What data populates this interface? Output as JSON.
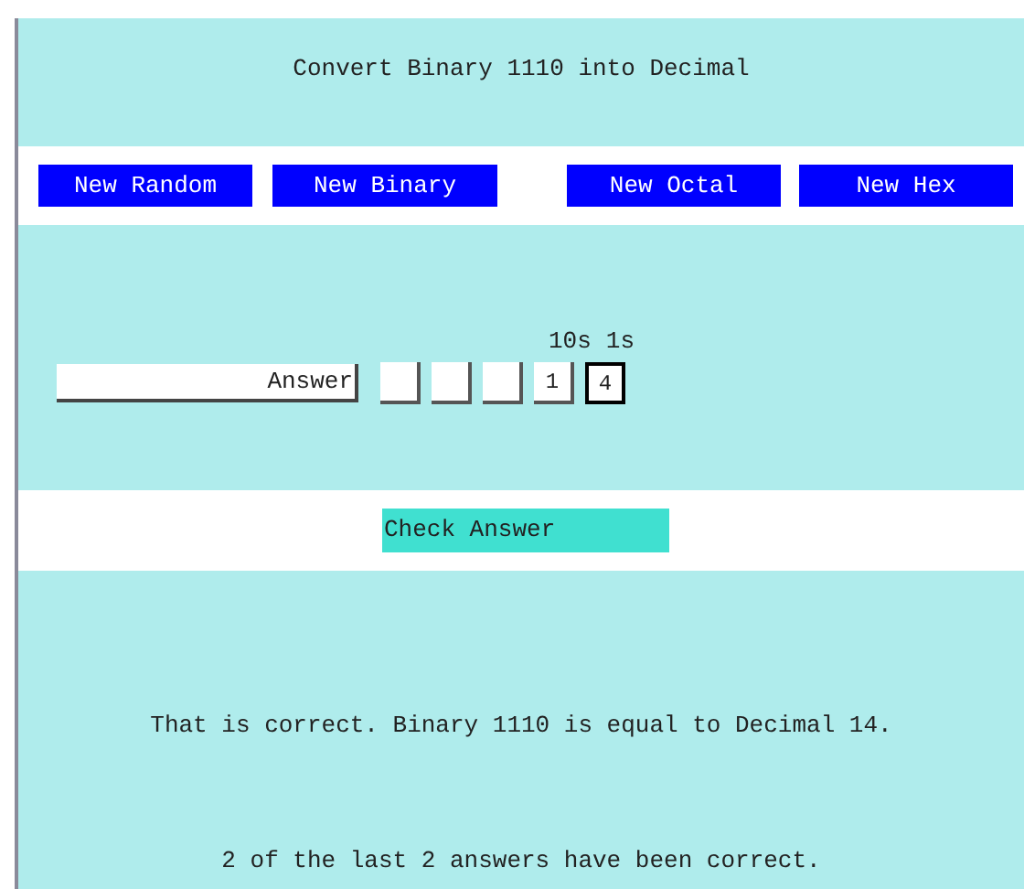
{
  "title": "Convert Binary 1110 into Decimal",
  "buttons": [
    "New Random",
    "New Binary",
    "New Octal",
    "New Hex"
  ],
  "place_labels": [
    "10s",
    "1s"
  ],
  "answer_label": "Answer",
  "digits": [
    {
      "focused": false
    },
    {
      "focused": false
    },
    {
      "focused": false
    },
    {
      "value": "1",
      "focused": false
    },
    {
      "value": "4",
      "focused": true
    }
  ],
  "check_button": "Check Answer",
  "result": "That is correct. Binary 1110 is equal to Decimal 14.",
  "score": "2 of the last 2 answers have been correct."
}
